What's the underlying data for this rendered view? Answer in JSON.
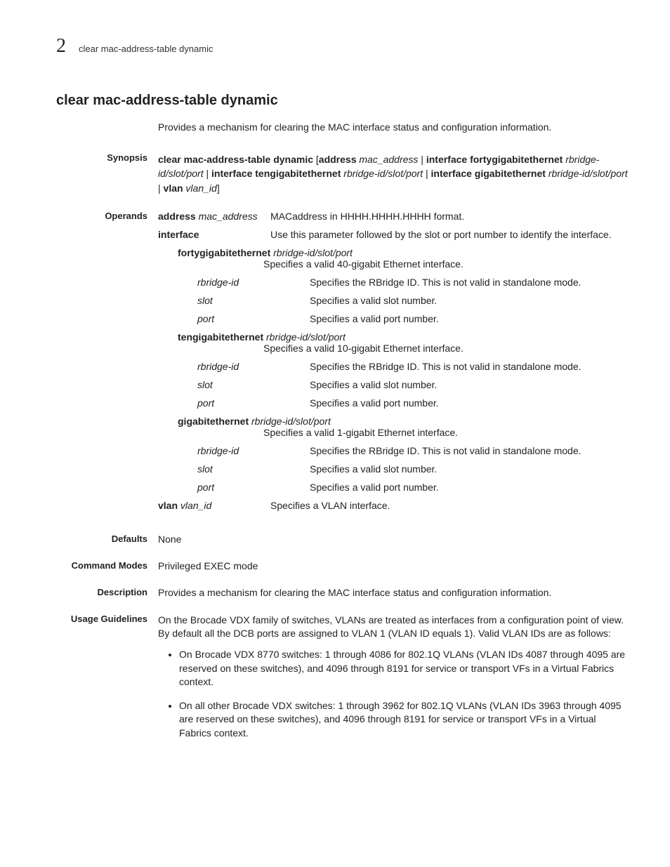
{
  "header": {
    "chapter": "2",
    "running_title": "clear mac-address-table dynamic"
  },
  "title": "clear mac-address-table dynamic",
  "summary": "Provides a mechanism for clearing the MAC interface status and configuration information.",
  "synopsis": {
    "label": "Synopsis",
    "parts": {
      "cmd": "clear mac-address-table dynamic",
      "open": " [",
      "addr_kw": "address",
      "addr_arg": " mac_address",
      "pipe1": " | ",
      "iface_kw": "interface fortygigabitethernet",
      "iface_arg": " rbridge-id/slot/port",
      "pipe2": " | ",
      "iface2_kw": "interface tengigabitethernet",
      "iface2_arg": " rbridge-id/slot/port",
      "pipe3": " | ",
      "iface3_kw": "interface gigabitethernet",
      "iface3_arg": " rbridge-id/slot/port",
      "pipe4": " | ",
      "vlan_kw": "vlan",
      "vlan_arg": " vlan_id",
      "close": "]"
    }
  },
  "operands": {
    "label": "Operands",
    "items": [
      {
        "term_bold": "address",
        "term_ital": " mac_address",
        "indent": 0,
        "desc": "MACaddress in HHHH.HHHH.HHHH format."
      },
      {
        "term_bold": "interface",
        "term_ital": "",
        "indent": 0,
        "desc": "Use this parameter followed by the slot or port number to identify the interface."
      },
      {
        "term_bold": "fortygigabitethernet",
        "term_ital": " rbridge-id/slot/port",
        "indent": 1,
        "desc": "Specifies a valid 40-gigabit Ethernet interface.",
        "wide": true
      },
      {
        "term_bold": "",
        "term_ital": "rbridge-id",
        "indent": 2,
        "desc": "Specifies the RBridge ID. This is not valid in standalone mode."
      },
      {
        "term_bold": "",
        "term_ital": "slot",
        "indent": 2,
        "desc": "Specifies a valid slot number."
      },
      {
        "term_bold": "",
        "term_ital": "port",
        "indent": 2,
        "desc": "Specifies a valid port number."
      },
      {
        "term_bold": "tengigabitethernet",
        "term_ital": " rbridge-id/slot/port",
        "indent": 1,
        "desc": "Specifies a valid 10-gigabit Ethernet interface.",
        "wide": true
      },
      {
        "term_bold": "",
        "term_ital": "rbridge-id",
        "indent": 2,
        "desc": "Specifies the RBridge ID. This is not valid in standalone mode."
      },
      {
        "term_bold": "",
        "term_ital": "slot",
        "indent": 2,
        "desc": "Specifies a valid slot number."
      },
      {
        "term_bold": "",
        "term_ital": "port",
        "indent": 2,
        "desc": "Specifies a valid port number."
      },
      {
        "term_bold": "gigabitethernet",
        "term_ital": " rbridge-id/slot/port",
        "indent": 1,
        "desc": "Specifies a valid 1-gigabit Ethernet interface.",
        "wide": true
      },
      {
        "term_bold": "",
        "term_ital": "rbridge-id",
        "indent": 2,
        "desc": "Specifies the RBridge ID. This is not valid in standalone mode."
      },
      {
        "term_bold": "",
        "term_ital": "slot",
        "indent": 2,
        "desc": "Specifies a valid slot number."
      },
      {
        "term_bold": "",
        "term_ital": "port",
        "indent": 2,
        "desc": "Specifies a valid port number."
      },
      {
        "term_bold": "vlan",
        "term_ital": " vlan_id",
        "indent": 0,
        "desc": "Specifies a VLAN interface."
      }
    ]
  },
  "defaults": {
    "label": "Defaults",
    "text": "None"
  },
  "modes": {
    "label": "Command Modes",
    "text": "Privileged EXEC mode"
  },
  "description": {
    "label": "Description",
    "text": "Provides a mechanism for clearing the MAC interface status and configuration information."
  },
  "usage": {
    "label": "Usage Guidelines",
    "intro": "On the Brocade VDX family of switches, VLANs are treated as interfaces from a configuration point of view. By default all the DCB ports are assigned to VLAN 1 (VLAN ID equals 1). Valid VLAN IDs are as follows:",
    "bullets": [
      "On Brocade VDX 8770 switches: 1 through 4086 for 802.1Q VLANs (VLAN IDs 4087 through 4095 are reserved on these switches), and 4096 through 8191 for service or transport VFs in a Virtual Fabrics context.",
      "On all other Brocade VDX switches: 1 through 3962 for 802.1Q VLANs (VLAN IDs 3963 through 4095 are reserved on these switches), and 4096 through 8191 for service or transport VFs in a Virtual Fabrics context."
    ]
  }
}
